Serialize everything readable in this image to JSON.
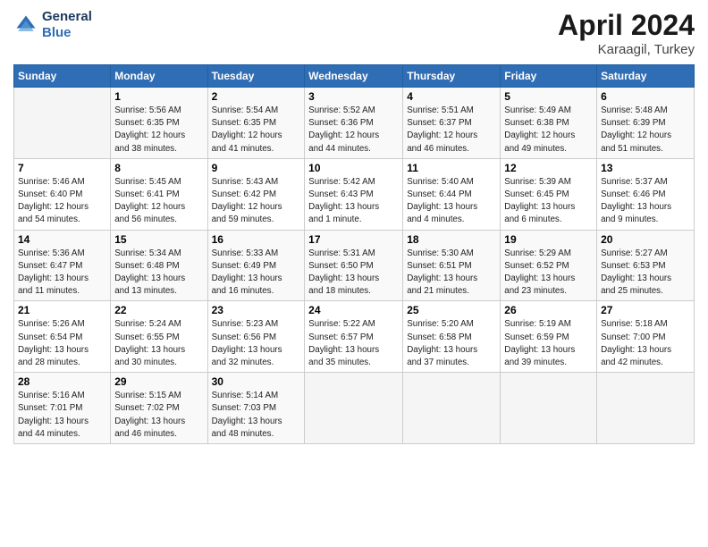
{
  "header": {
    "logo_line1": "General",
    "logo_line2": "Blue",
    "title": "April 2024",
    "subtitle": "Karaagil, Turkey"
  },
  "days_of_week": [
    "Sunday",
    "Monday",
    "Tuesday",
    "Wednesday",
    "Thursday",
    "Friday",
    "Saturday"
  ],
  "weeks": [
    [
      {
        "day": "",
        "info": ""
      },
      {
        "day": "1",
        "info": "Sunrise: 5:56 AM\nSunset: 6:35 PM\nDaylight: 12 hours\nand 38 minutes."
      },
      {
        "day": "2",
        "info": "Sunrise: 5:54 AM\nSunset: 6:35 PM\nDaylight: 12 hours\nand 41 minutes."
      },
      {
        "day": "3",
        "info": "Sunrise: 5:52 AM\nSunset: 6:36 PM\nDaylight: 12 hours\nand 44 minutes."
      },
      {
        "day": "4",
        "info": "Sunrise: 5:51 AM\nSunset: 6:37 PM\nDaylight: 12 hours\nand 46 minutes."
      },
      {
        "day": "5",
        "info": "Sunrise: 5:49 AM\nSunset: 6:38 PM\nDaylight: 12 hours\nand 49 minutes."
      },
      {
        "day": "6",
        "info": "Sunrise: 5:48 AM\nSunset: 6:39 PM\nDaylight: 12 hours\nand 51 minutes."
      }
    ],
    [
      {
        "day": "7",
        "info": "Sunrise: 5:46 AM\nSunset: 6:40 PM\nDaylight: 12 hours\nand 54 minutes."
      },
      {
        "day": "8",
        "info": "Sunrise: 5:45 AM\nSunset: 6:41 PM\nDaylight: 12 hours\nand 56 minutes."
      },
      {
        "day": "9",
        "info": "Sunrise: 5:43 AM\nSunset: 6:42 PM\nDaylight: 12 hours\nand 59 minutes."
      },
      {
        "day": "10",
        "info": "Sunrise: 5:42 AM\nSunset: 6:43 PM\nDaylight: 13 hours\nand 1 minute."
      },
      {
        "day": "11",
        "info": "Sunrise: 5:40 AM\nSunset: 6:44 PM\nDaylight: 13 hours\nand 4 minutes."
      },
      {
        "day": "12",
        "info": "Sunrise: 5:39 AM\nSunset: 6:45 PM\nDaylight: 13 hours\nand 6 minutes."
      },
      {
        "day": "13",
        "info": "Sunrise: 5:37 AM\nSunset: 6:46 PM\nDaylight: 13 hours\nand 9 minutes."
      }
    ],
    [
      {
        "day": "14",
        "info": "Sunrise: 5:36 AM\nSunset: 6:47 PM\nDaylight: 13 hours\nand 11 minutes."
      },
      {
        "day": "15",
        "info": "Sunrise: 5:34 AM\nSunset: 6:48 PM\nDaylight: 13 hours\nand 13 minutes."
      },
      {
        "day": "16",
        "info": "Sunrise: 5:33 AM\nSunset: 6:49 PM\nDaylight: 13 hours\nand 16 minutes."
      },
      {
        "day": "17",
        "info": "Sunrise: 5:31 AM\nSunset: 6:50 PM\nDaylight: 13 hours\nand 18 minutes."
      },
      {
        "day": "18",
        "info": "Sunrise: 5:30 AM\nSunset: 6:51 PM\nDaylight: 13 hours\nand 21 minutes."
      },
      {
        "day": "19",
        "info": "Sunrise: 5:29 AM\nSunset: 6:52 PM\nDaylight: 13 hours\nand 23 minutes."
      },
      {
        "day": "20",
        "info": "Sunrise: 5:27 AM\nSunset: 6:53 PM\nDaylight: 13 hours\nand 25 minutes."
      }
    ],
    [
      {
        "day": "21",
        "info": "Sunrise: 5:26 AM\nSunset: 6:54 PM\nDaylight: 13 hours\nand 28 minutes."
      },
      {
        "day": "22",
        "info": "Sunrise: 5:24 AM\nSunset: 6:55 PM\nDaylight: 13 hours\nand 30 minutes."
      },
      {
        "day": "23",
        "info": "Sunrise: 5:23 AM\nSunset: 6:56 PM\nDaylight: 13 hours\nand 32 minutes."
      },
      {
        "day": "24",
        "info": "Sunrise: 5:22 AM\nSunset: 6:57 PM\nDaylight: 13 hours\nand 35 minutes."
      },
      {
        "day": "25",
        "info": "Sunrise: 5:20 AM\nSunset: 6:58 PM\nDaylight: 13 hours\nand 37 minutes."
      },
      {
        "day": "26",
        "info": "Sunrise: 5:19 AM\nSunset: 6:59 PM\nDaylight: 13 hours\nand 39 minutes."
      },
      {
        "day": "27",
        "info": "Sunrise: 5:18 AM\nSunset: 7:00 PM\nDaylight: 13 hours\nand 42 minutes."
      }
    ],
    [
      {
        "day": "28",
        "info": "Sunrise: 5:16 AM\nSunset: 7:01 PM\nDaylight: 13 hours\nand 44 minutes."
      },
      {
        "day": "29",
        "info": "Sunrise: 5:15 AM\nSunset: 7:02 PM\nDaylight: 13 hours\nand 46 minutes."
      },
      {
        "day": "30",
        "info": "Sunrise: 5:14 AM\nSunset: 7:03 PM\nDaylight: 13 hours\nand 48 minutes."
      },
      {
        "day": "",
        "info": ""
      },
      {
        "day": "",
        "info": ""
      },
      {
        "day": "",
        "info": ""
      },
      {
        "day": "",
        "info": ""
      }
    ]
  ]
}
